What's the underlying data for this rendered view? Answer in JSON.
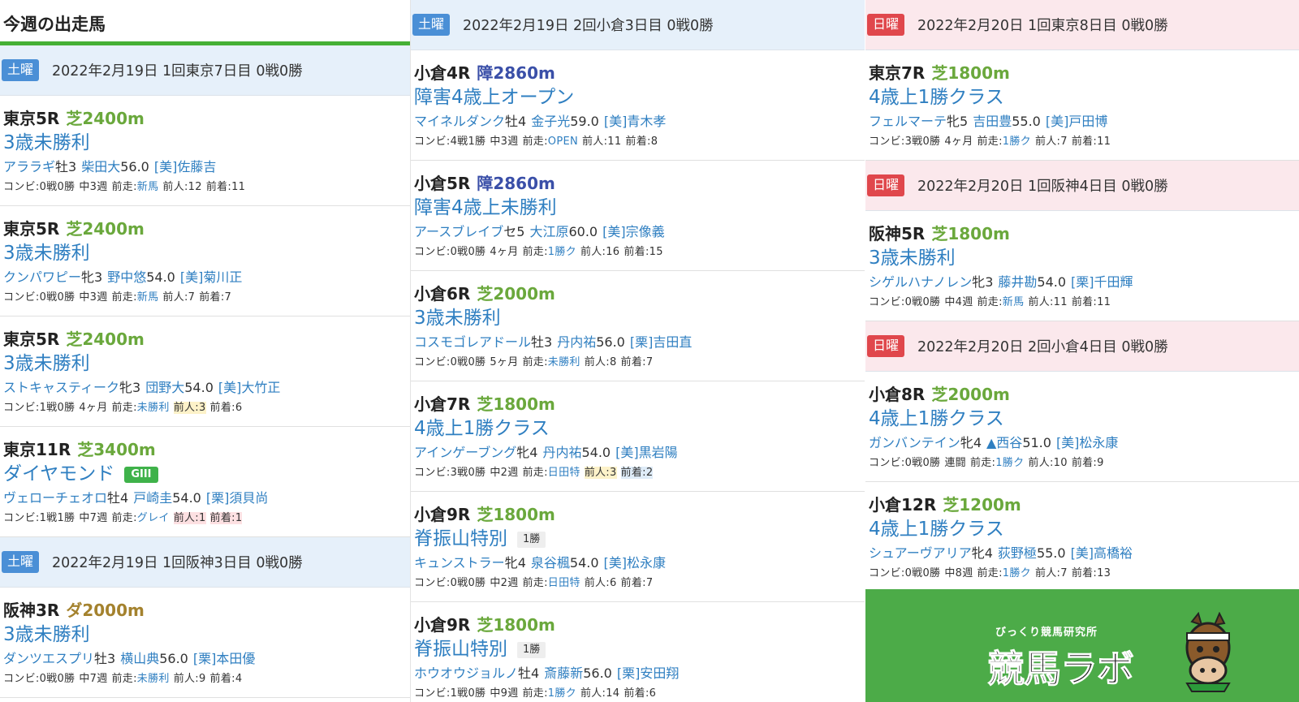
{
  "page_title": "今週の出走馬",
  "col1": [
    {
      "type": "day",
      "day": "土曜",
      "day_kind": "sat",
      "text": "2022年2月19日 1回東京7日目 0戦0勝"
    },
    {
      "type": "race",
      "name": "東京5R",
      "course": "芝2400m",
      "course_kind": "turf",
      "cls": "3歳未勝利",
      "horse": "アララギ",
      "sexage": "牡3",
      "jockey": "柴田大",
      "weight": "56.0",
      "trainer": "[美]佐藤吉",
      "combi": "コンビ:0戦0勝",
      "interval": "中3週",
      "prev_label": "前走:",
      "prev": "新馬",
      "ninki": "前人:12",
      "chaku": "前着:11"
    },
    {
      "type": "race",
      "name": "東京5R",
      "course": "芝2400m",
      "course_kind": "turf",
      "cls": "3歳未勝利",
      "horse": "クンパワピー",
      "sexage": "牝3",
      "jockey": "野中悠",
      "weight": "54.0",
      "trainer": "[美]菊川正",
      "combi": "コンビ:0戦0勝",
      "interval": "中3週",
      "prev_label": "前走:",
      "prev": "新馬",
      "ninki": "前人:7",
      "chaku": "前着:7"
    },
    {
      "type": "race",
      "name": "東京5R",
      "course": "芝2400m",
      "course_kind": "turf",
      "cls": "3歳未勝利",
      "horse": "ストキャスティーク",
      "sexage": "牝3",
      "jockey": "団野大",
      "weight": "54.0",
      "trainer": "[美]大竹正",
      "combi": "コンビ:1戦0勝",
      "interval": "4ヶ月",
      "prev_label": "前走:",
      "prev": "未勝利",
      "ninki": "前人:3",
      "ninki_hl": "y",
      "chaku": "前着:6"
    },
    {
      "type": "race",
      "name": "東京11R",
      "course": "芝3400m",
      "course_kind": "turf",
      "cls": "ダイヤモンド",
      "grade": "GIII",
      "horse": "ヴェローチェオロ",
      "sexage": "牡4",
      "jockey": "戸崎圭",
      "weight": "54.0",
      "trainer": "[栗]須貝尚",
      "combi": "コンビ:1戦1勝",
      "interval": "中7週",
      "prev_label": "前走:",
      "prev": "グレイ",
      "ninki": "前人:1",
      "ninki_hl": "r",
      "chaku": "前着:1",
      "chaku_hl": "r"
    },
    {
      "type": "day",
      "day": "土曜",
      "day_kind": "sat",
      "text": "2022年2月19日 1回阪神3日目 0戦0勝"
    },
    {
      "type": "race",
      "name": "阪神3R",
      "course": "ダ2000m",
      "course_kind": "dirt",
      "cls": "3歳未勝利",
      "horse": "ダンツエスプリ",
      "sexage": "牡3",
      "jockey": "横山典",
      "weight": "56.0",
      "trainer": "[栗]本田優",
      "combi": "コンビ:0戦0勝",
      "interval": "中7週",
      "prev_label": "前走:",
      "prev": "未勝利",
      "ninki": "前人:9",
      "chaku": "前着:4"
    }
  ],
  "col2": [
    {
      "type": "day",
      "day": "土曜",
      "day_kind": "sat",
      "text": "2022年2月19日 2回小倉3日目 0戦0勝"
    },
    {
      "type": "race",
      "name": "小倉4R",
      "course": "障2860m",
      "course_kind": "hurd",
      "cls": "障害4歳上オープン",
      "horse": "マイネルダンク",
      "sexage": "牡4",
      "jockey": "金子光",
      "weight": "59.0",
      "trainer": "[美]青木孝",
      "combi": "コンビ:4戦1勝",
      "interval": "中3週",
      "prev_label": "前走:",
      "prev": "OPEN",
      "ninki": "前人:11",
      "chaku": "前着:8"
    },
    {
      "type": "race",
      "name": "小倉5R",
      "course": "障2860m",
      "course_kind": "hurd",
      "cls": "障害4歳上未勝利",
      "horse": "アースブレイブ",
      "sexage": "セ5",
      "jockey": "大江原",
      "weight": "60.0",
      "trainer": "[美]宗像義",
      "combi": "コンビ:0戦0勝",
      "interval": "4ヶ月",
      "prev_label": "前走:",
      "prev": "1勝ク",
      "ninki": "前人:16",
      "chaku": "前着:15"
    },
    {
      "type": "race",
      "name": "小倉6R",
      "course": "芝2000m",
      "course_kind": "turf",
      "cls": "3歳未勝利",
      "horse": "コスモゴレアドール",
      "sexage": "牡3",
      "jockey": "丹内祐",
      "weight": "56.0",
      "trainer": "[栗]吉田直",
      "combi": "コンビ:0戦0勝",
      "interval": "5ヶ月",
      "prev_label": "前走:",
      "prev": "未勝利",
      "ninki": "前人:8",
      "chaku": "前着:7"
    },
    {
      "type": "race",
      "name": "小倉7R",
      "course": "芝1800m",
      "course_kind": "turf",
      "cls": "4歳上1勝クラス",
      "horse": "アインゲーブング",
      "sexage": "牝4",
      "jockey": "丹内祐",
      "weight": "54.0",
      "trainer": "[美]黒岩陽",
      "combi": "コンビ:3戦0勝",
      "interval": "中2週",
      "prev_label": "前走:",
      "prev": "日田特",
      "ninki": "前人:3",
      "ninki_hl": "y",
      "chaku": "前着:2",
      "chaku_hl": "b"
    },
    {
      "type": "race",
      "name": "小倉9R",
      "course": "芝1800m",
      "course_kind": "turf",
      "cls": "脊振山特別",
      "tag": "1勝",
      "horse": "キュンストラー",
      "sexage": "牝4",
      "jockey": "泉谷楓",
      "weight": "54.0",
      "trainer": "[美]松永康",
      "combi": "コンビ:0戦0勝",
      "interval": "中2週",
      "prev_label": "前走:",
      "prev": "日田特",
      "ninki": "前人:6",
      "chaku": "前着:7"
    },
    {
      "type": "race",
      "name": "小倉9R",
      "course": "芝1800m",
      "course_kind": "turf",
      "cls": "脊振山特別",
      "tag": "1勝",
      "horse": "ホウオウジョルノ",
      "sexage": "牡4",
      "jockey": "斎藤新",
      "weight": "56.0",
      "trainer": "[栗]安田翔",
      "combi": "コンビ:1戦0勝",
      "interval": "中9週",
      "prev_label": "前走:",
      "prev": "1勝ク",
      "ninki": "前人:14",
      "chaku": "前着:6"
    }
  ],
  "col3": [
    {
      "type": "day",
      "day": "日曜",
      "day_kind": "sun",
      "text": "2022年2月20日 1回東京8日目 0戦0勝"
    },
    {
      "type": "race",
      "name": "東京7R",
      "course": "芝1800m",
      "course_kind": "turf",
      "cls": "4歳上1勝クラス",
      "horse": "フェルマーテ",
      "sexage": "牝5",
      "jockey": "吉田豊",
      "weight": "55.0",
      "trainer": "[美]戸田博",
      "combi": "コンビ:3戦0勝",
      "interval": "4ヶ月",
      "prev_label": "前走:",
      "prev": "1勝ク",
      "ninki": "前人:7",
      "chaku": "前着:11"
    },
    {
      "type": "day",
      "day": "日曜",
      "day_kind": "sun",
      "text": "2022年2月20日 1回阪神4日目 0戦0勝"
    },
    {
      "type": "race",
      "name": "阪神5R",
      "course": "芝1800m",
      "course_kind": "turf",
      "cls": "3歳未勝利",
      "horse": "シゲルハナノレン",
      "sexage": "牝3",
      "jockey": "藤井勘",
      "weight": "54.0",
      "trainer": "[栗]千田輝",
      "combi": "コンビ:0戦0勝",
      "interval": "中4週",
      "prev_label": "前走:",
      "prev": "新馬",
      "ninki": "前人:11",
      "chaku": "前着:11"
    },
    {
      "type": "day",
      "day": "日曜",
      "day_kind": "sun",
      "text": "2022年2月20日 2回小倉4日目 0戦0勝"
    },
    {
      "type": "race",
      "name": "小倉8R",
      "course": "芝2000m",
      "course_kind": "turf",
      "cls": "4歳上1勝クラス",
      "horse": "ガンバンテイン",
      "sexage": "牝4",
      "jockey": "▲西谷",
      "weight": "51.0",
      "trainer": "[美]松永康",
      "combi": "コンビ:0戦0勝",
      "interval": "連闘",
      "prev_label": "前走:",
      "prev": "1勝ク",
      "ninki": "前人:10",
      "chaku": "前着:9"
    },
    {
      "type": "race",
      "name": "小倉12R",
      "course": "芝1200m",
      "course_kind": "turf",
      "cls": "4歳上1勝クラス",
      "horse": "シュアーヴアリア",
      "sexage": "牝4",
      "jockey": "荻野極",
      "weight": "55.0",
      "trainer": "[美]高橋裕",
      "combi": "コンビ:0戦0勝",
      "interval": "中8週",
      "prev_label": "前走:",
      "prev": "1勝ク",
      "ninki": "前人:7",
      "chaku": "前着:13"
    }
  ],
  "logo": {
    "sub": "びっくり競馬研究所",
    "main": "競馬ラボ"
  }
}
